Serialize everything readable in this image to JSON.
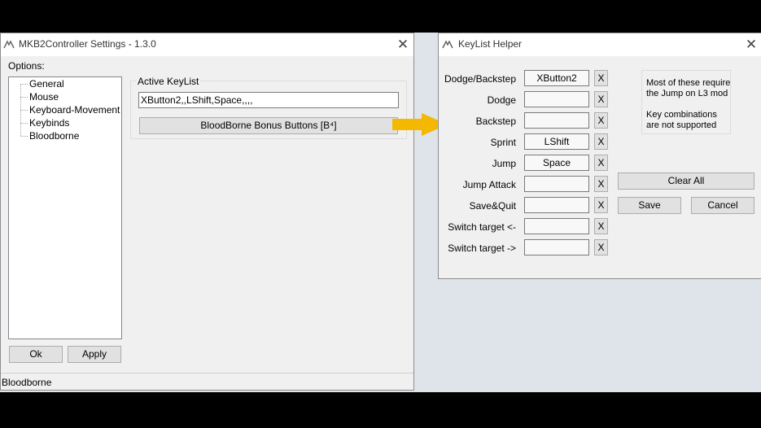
{
  "settings_window": {
    "title": "MKB2Controller Settings  -  1.3.0",
    "options_label": "Options:",
    "tree_items": [
      "General",
      "Mouse",
      "Keyboard-Movement",
      "Keybinds",
      "Bloodborne"
    ],
    "active_keylist_label": "Active KeyList",
    "active_keylist_value": "XButton2,,LShift,Space,,,,",
    "bonus_button_label": "BloodBorne Bonus Buttons [B⁴]",
    "ok_label": "Ok",
    "apply_label": "Apply",
    "status_text": "Bloodborne"
  },
  "helper_window": {
    "title": "KeyList Helper",
    "rows": [
      {
        "label": "Dodge/Backstep",
        "value": "XButton2"
      },
      {
        "label": "Dodge",
        "value": ""
      },
      {
        "label": "Backstep",
        "value": ""
      },
      {
        "label": "Sprint",
        "value": "LShift"
      },
      {
        "label": "Jump",
        "value": "Space"
      },
      {
        "label": "Jump Attack",
        "value": ""
      },
      {
        "label": "Save&Quit",
        "value": ""
      },
      {
        "label": "Switch target <-",
        "value": ""
      },
      {
        "label": "Switch target ->",
        "value": ""
      }
    ],
    "clear_label": "X",
    "note_line1": "Most of these require",
    "note_line2": "the Jump on L3 mod",
    "note_line3": "Key combinations",
    "note_line4": "are not supported",
    "clear_all_label": "Clear All",
    "save_label": "Save",
    "cancel_label": "Cancel"
  },
  "colors": {
    "arrow": "#f5b800",
    "window_bg": "#f0f0f0",
    "desktop": "#dfe3ea"
  }
}
